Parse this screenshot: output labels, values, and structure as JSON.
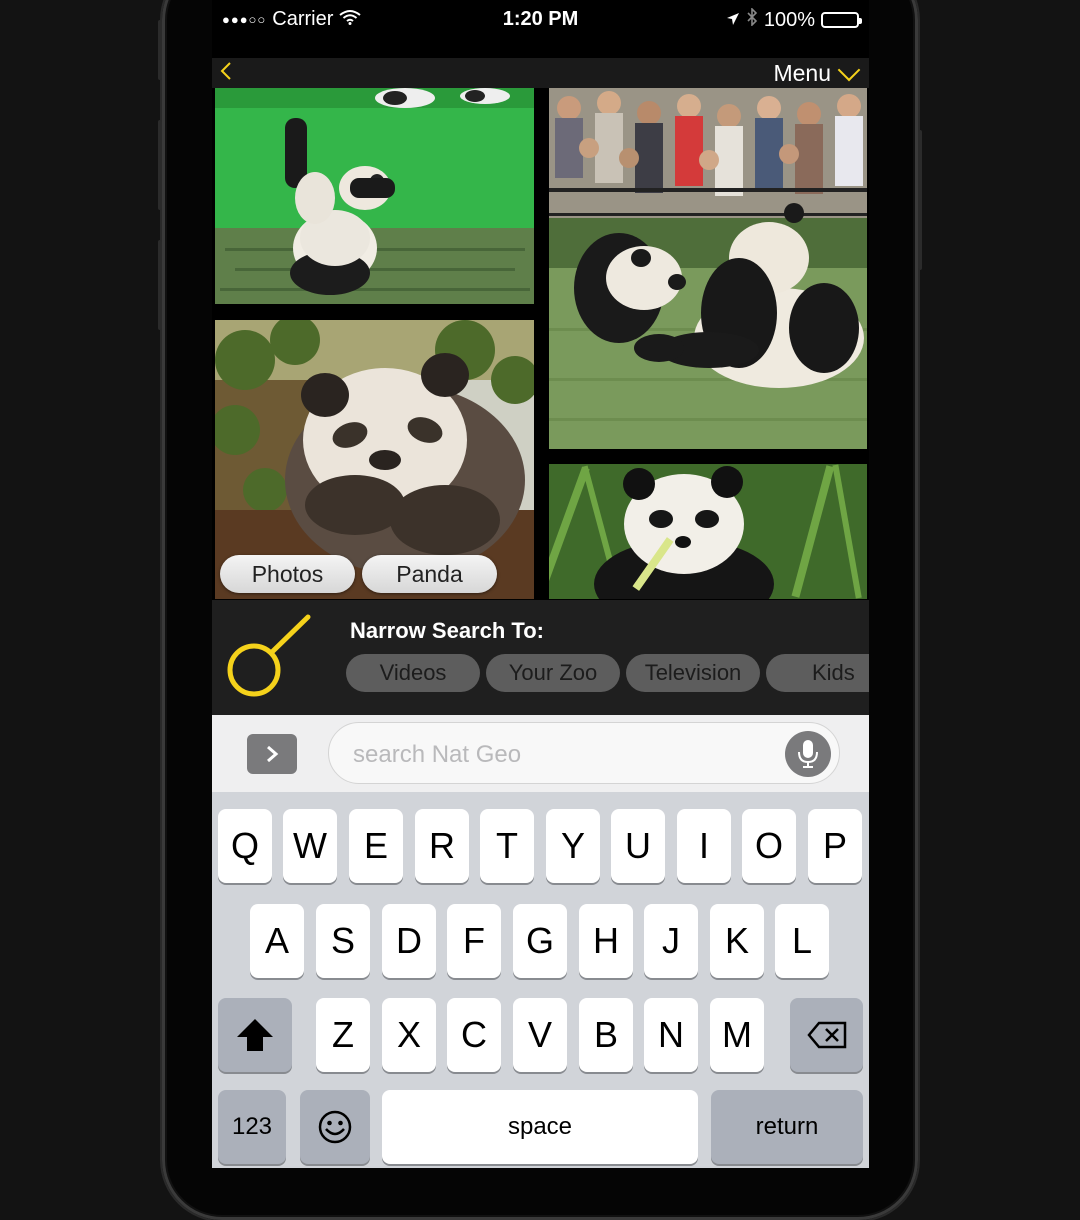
{
  "status_bar": {
    "signal": "●●●○○",
    "carrier": "Carrier",
    "time": "1:20 PM",
    "battery_percent": "100%",
    "battery_level": 1.0
  },
  "nav": {
    "back_icon": "chevron-left-icon",
    "menu_label": "Menu",
    "accent_color": "#f5d21b"
  },
  "photos": [
    {
      "subject": "panda-cub-green-table"
    },
    {
      "subject": "pandas-crowd"
    },
    {
      "subject": "panda-cub-sleeping"
    },
    {
      "subject": "panda-eating-bamboo"
    }
  ],
  "tags": [
    "Photos",
    "Panda"
  ],
  "narrow": {
    "title": "Narrow Search To:",
    "chips": [
      "Videos",
      "Your Zoo",
      "Television",
      "Kids"
    ]
  },
  "search": {
    "placeholder": "search Nat Geo",
    "value": ""
  },
  "keyboard": {
    "row1": [
      "Q",
      "W",
      "E",
      "R",
      "T",
      "Y",
      "U",
      "I",
      "O",
      "P"
    ],
    "row2": [
      "A",
      "S",
      "D",
      "F",
      "G",
      "H",
      "J",
      "K",
      "L"
    ],
    "row3": [
      "Z",
      "X",
      "C",
      "V",
      "B",
      "N",
      "M"
    ],
    "numbers_label": "123",
    "space_label": "space",
    "return_label": "return"
  }
}
